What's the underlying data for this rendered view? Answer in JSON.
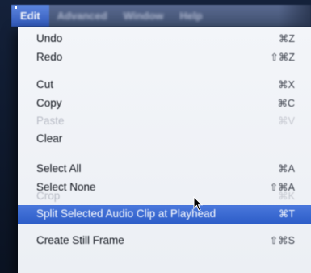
{
  "menubar": {
    "items": [
      {
        "label": "Edit",
        "active": true
      },
      {
        "label": "Advanced",
        "active": false
      },
      {
        "label": "Window",
        "active": false
      },
      {
        "label": "Help",
        "active": false
      }
    ]
  },
  "edit_menu": {
    "items": [
      {
        "label": "Undo",
        "shortcut": "⌘Z",
        "enabled": true
      },
      {
        "label": "Redo",
        "shortcut": "⇧⌘Z",
        "enabled": true
      },
      {
        "label": "Cut",
        "shortcut": "⌘X",
        "enabled": true
      },
      {
        "label": "Copy",
        "shortcut": "⌘C",
        "enabled": true
      },
      {
        "label": "Paste",
        "shortcut": "⌘V",
        "enabled": false
      },
      {
        "label": "Clear",
        "shortcut": "",
        "enabled": true
      },
      {
        "label": "Select All",
        "shortcut": "⌘A",
        "enabled": true
      },
      {
        "label": "Select None",
        "shortcut": "⇧⌘A",
        "enabled": true
      },
      {
        "label": "Crop",
        "shortcut": "⌘K",
        "enabled": false
      },
      {
        "label": "Split Selected Audio Clip at Playhead",
        "shortcut": "⌘T",
        "enabled": true,
        "highlighted": true
      },
      {
        "label": "Create Still Frame",
        "shortcut": "⇧⌘S",
        "enabled": true
      }
    ]
  },
  "colors": {
    "menubar_bg": "#4a5a7c",
    "active_bg": "#3a68d0",
    "menu_bg": "#eef1f6",
    "text": "#10141c",
    "disabled_text": "#b8bcc6",
    "highlight_text": "#ffffff"
  }
}
